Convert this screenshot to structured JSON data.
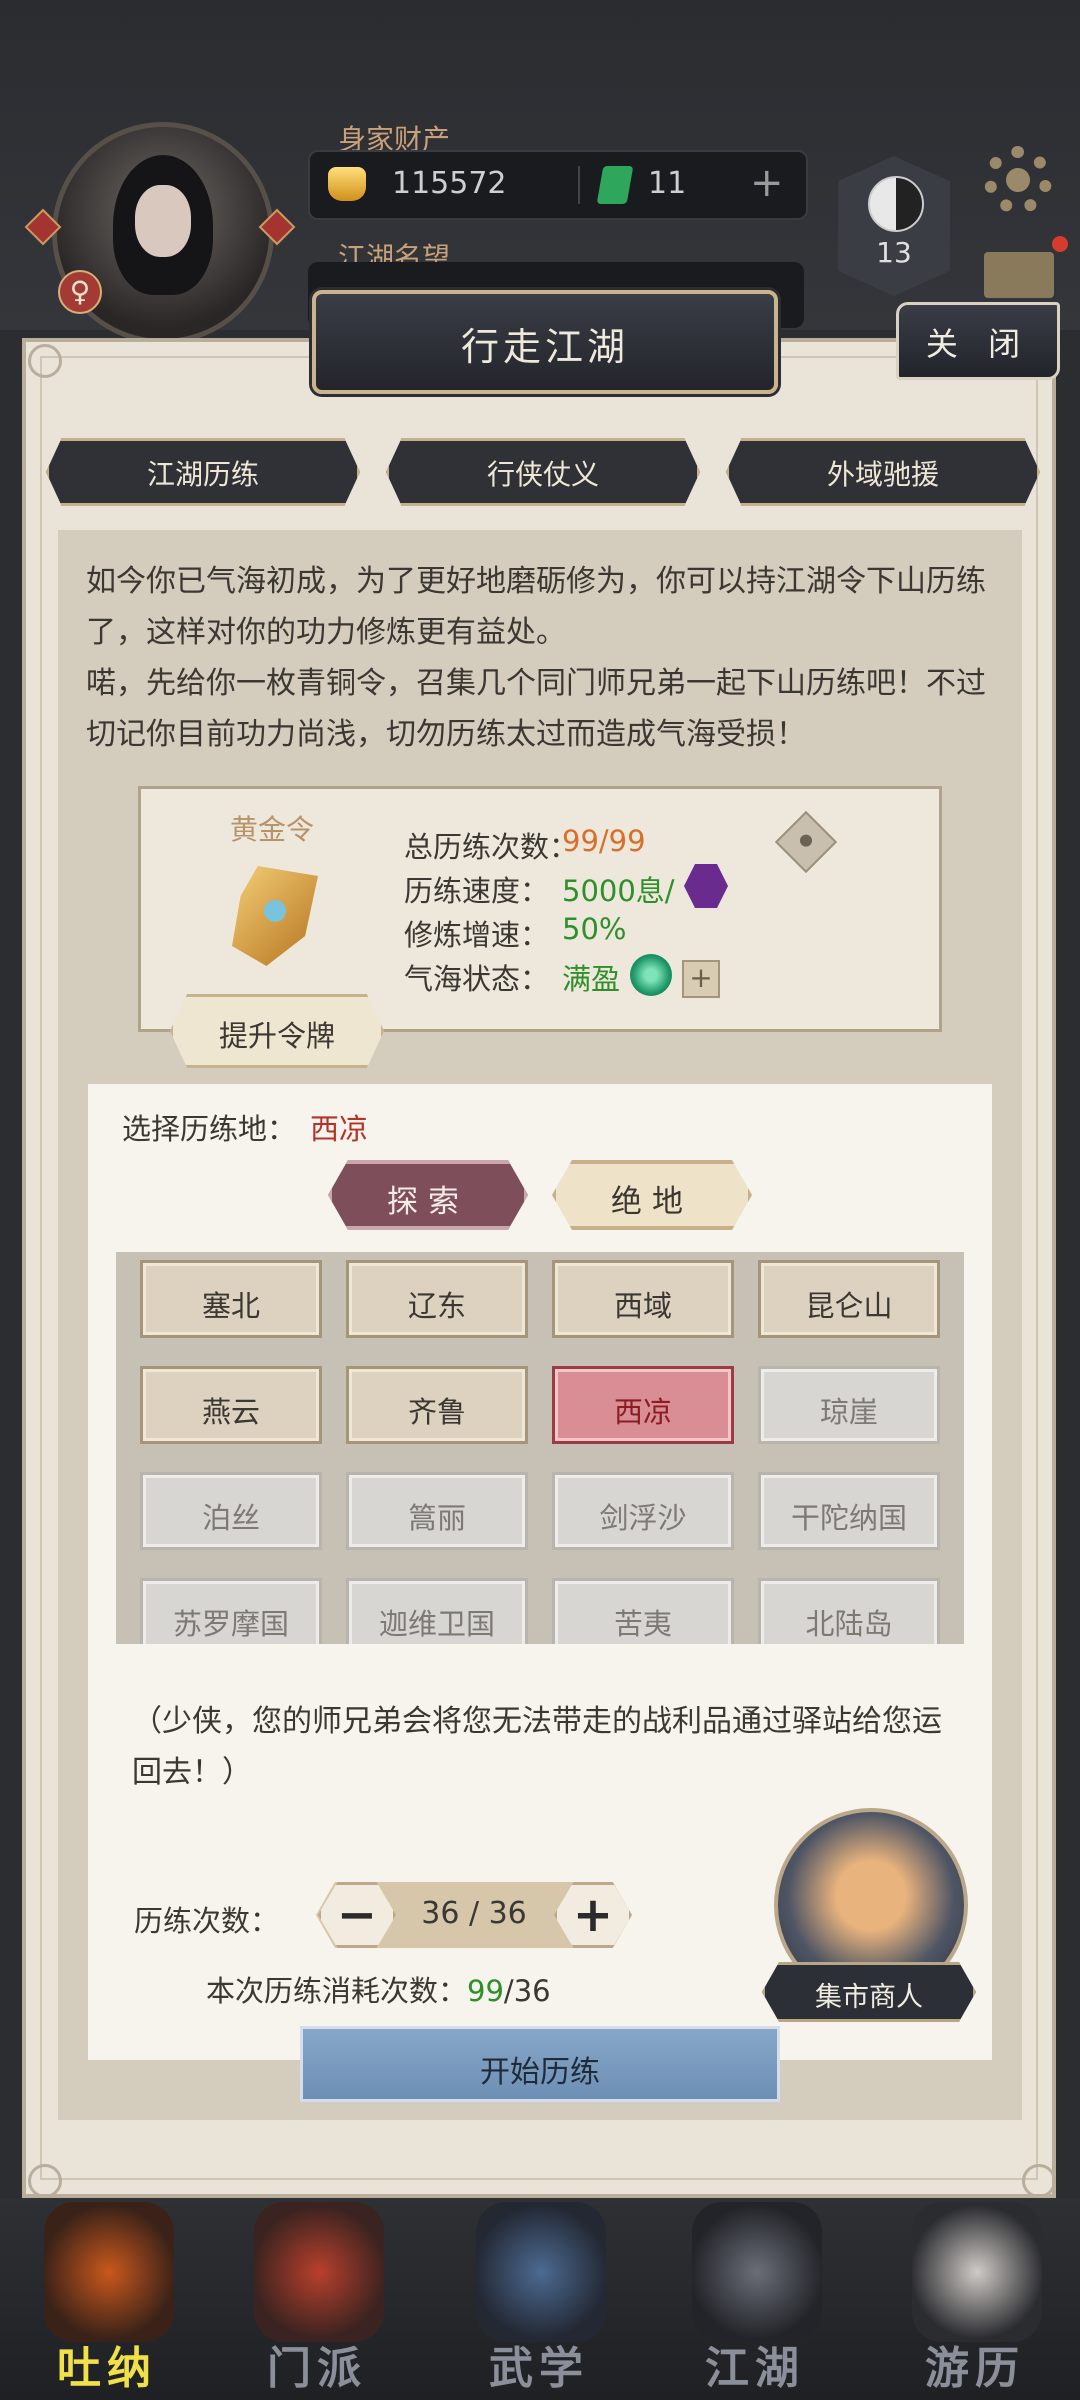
{
  "hud": {
    "wealth_title": "身家财产",
    "gold_amount": "115572",
    "jade_amount": "11",
    "plus_label": "+",
    "fame_title": "江湖名望",
    "gender_symbol": "♀",
    "level": "13",
    "icons": [
      "gold-ingot-icon",
      "jade-icon",
      "yinyang-icon",
      "gear-icon",
      "mail-icon"
    ]
  },
  "modal": {
    "title": "行走江湖",
    "close_label": "关 闭",
    "tabs": [
      {
        "label": "江湖历练",
        "active": true
      },
      {
        "label": "行侠仗义",
        "active": false
      },
      {
        "label": "外域驰援",
        "active": false
      }
    ],
    "intro_text": "如今你已气海初成，为了更好地磨砺修为，你可以持江湖令下山历练了，这样对你的功力修炼更有益处。\n喏，先给你一枚青铜令，召集几个同门师兄弟一起下山历练吧！不过切记你目前功力尚浅，切勿历练太过而造成气海受损！",
    "token": {
      "name": "黄金令",
      "stats": [
        {
          "label": "总历练次数：",
          "value": "99/99",
          "color": "#d8702a"
        },
        {
          "label": "历练速度：",
          "value": "5000息/",
          "color": "#2f8f2a"
        },
        {
          "label": "修炼增速：",
          "value": "50%",
          "color": "#2f8f2a"
        },
        {
          "label": "气海状态：",
          "value": "满盈",
          "color": "#2f8f2a"
        }
      ],
      "upgrade_label": "提升令牌"
    },
    "select": {
      "label": "选择历练地：",
      "value": "西凉",
      "modes": [
        {
          "label": "探索",
          "active": true
        },
        {
          "label": "绝地",
          "active": false
        }
      ],
      "places": [
        {
          "name": "塞北",
          "state": "unlocked"
        },
        {
          "name": "辽东",
          "state": "unlocked"
        },
        {
          "name": "西域",
          "state": "unlocked"
        },
        {
          "name": "昆仑山",
          "state": "unlocked"
        },
        {
          "name": "燕云",
          "state": "unlocked"
        },
        {
          "name": "齐鲁",
          "state": "unlocked"
        },
        {
          "name": "西凉",
          "state": "selected"
        },
        {
          "name": "琼崖",
          "state": "locked"
        },
        {
          "name": "泊丝",
          "state": "locked"
        },
        {
          "name": "篙丽",
          "state": "locked"
        },
        {
          "name": "剑浮沙",
          "state": "locked"
        },
        {
          "name": "干陀纳国",
          "state": "locked"
        },
        {
          "name": "苏罗摩国",
          "state": "locked"
        },
        {
          "name": "迦维卫国",
          "state": "locked"
        },
        {
          "name": "苦夷",
          "state": "locked"
        },
        {
          "name": "北陆岛",
          "state": "locked"
        }
      ]
    },
    "note": "（少侠，您的师兄弟会将您无法带走的战利品通过驿站给您运回去！）",
    "count": {
      "label": "历练次数：",
      "minus": "−",
      "plus": "+",
      "value": "36 / 36",
      "cost_label": "本次历练消耗次数：",
      "cost_used": "99",
      "cost_total": "/36"
    },
    "merchant_label": "集市商人",
    "start_label": "开始历练"
  },
  "bottom_nav": [
    {
      "label": "吐纳",
      "color": "#f0e04a"
    },
    {
      "label": "门派",
      "color": "#8a8f9a"
    },
    {
      "label": "武学",
      "color": "#8a8f9a"
    },
    {
      "label": "江湖",
      "color": "#8a8f9a"
    },
    {
      "label": "游历",
      "color": "#8a8f9a"
    }
  ]
}
